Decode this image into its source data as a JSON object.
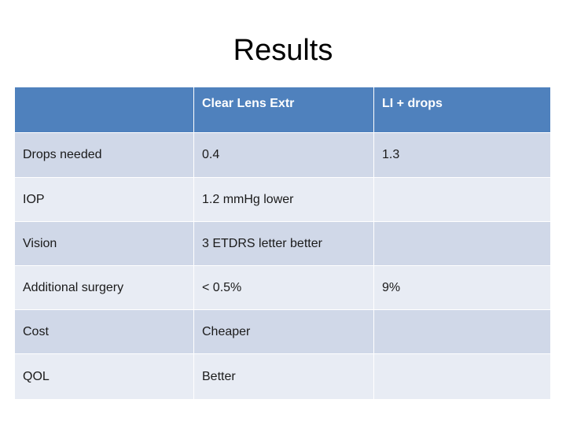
{
  "slide": {
    "title": "Results"
  },
  "table": {
    "headers": [
      "",
      "Clear Lens Extr",
      "LI + drops"
    ],
    "rows": [
      {
        "label": "Drops needed",
        "clear_lens_extr": "0.4",
        "li_plus_drops": "1.3"
      },
      {
        "label": "IOP",
        "clear_lens_extr": "1.2 mmHg lower",
        "li_plus_drops": ""
      },
      {
        "label": "Vision",
        "clear_lens_extr": "3 ETDRS letter better",
        "li_plus_drops": ""
      },
      {
        "label": "Additional surgery",
        "clear_lens_extr": "< 0.5%",
        "li_plus_drops": "9%"
      },
      {
        "label": "Cost",
        "clear_lens_extr": "Cheaper",
        "li_plus_drops": ""
      },
      {
        "label": "QOL",
        "clear_lens_extr": "Better",
        "li_plus_drops": ""
      }
    ]
  },
  "colors": {
    "header_blue": "#4F81BD",
    "band_dark": "#D0D8E8",
    "band_light": "#E8ECF4",
    "background": "#FFFFFF",
    "text": "#1A1A1A",
    "header_text": "#FFFFFF"
  }
}
